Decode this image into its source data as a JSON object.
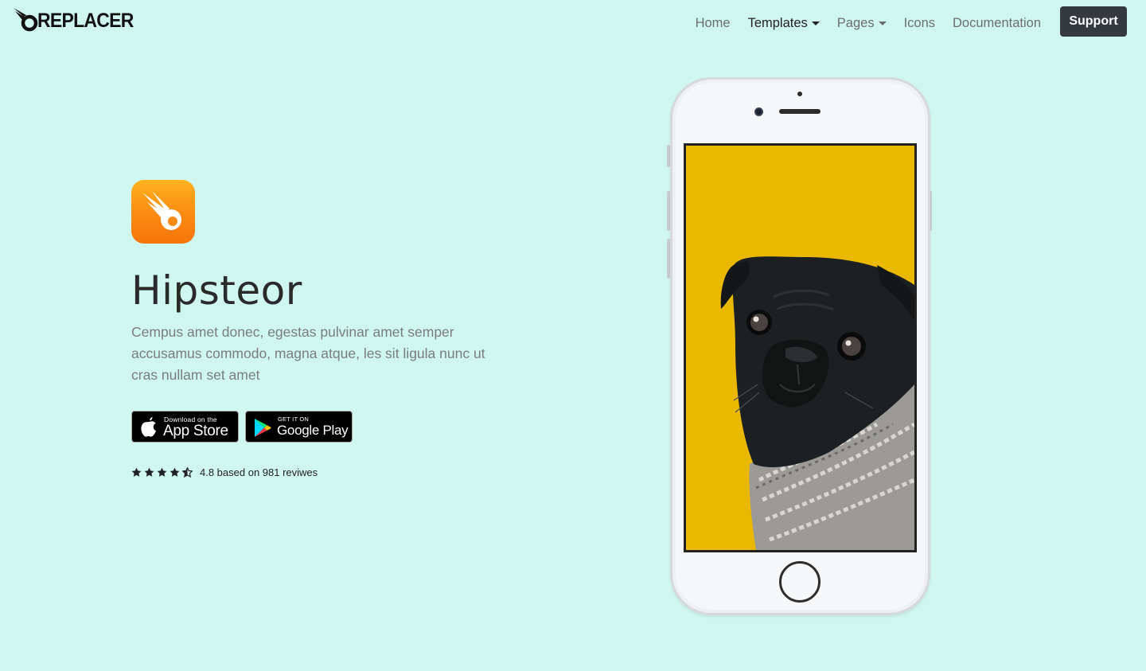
{
  "brand": {
    "name": "REPLACER",
    "icon": "replacer-logo-icon"
  },
  "nav": {
    "items": [
      {
        "label": "Home",
        "active": false,
        "dropdown": false
      },
      {
        "label": "Templates",
        "active": true,
        "dropdown": true
      },
      {
        "label": "Pages",
        "active": false,
        "dropdown": true
      },
      {
        "label": "Icons",
        "active": false,
        "dropdown": false
      },
      {
        "label": "Documentation",
        "active": false,
        "dropdown": false
      }
    ],
    "support_label": "Support"
  },
  "hero": {
    "app_icon": "comet-app-icon",
    "title": "Hipsteor",
    "description": "Cempus amet donec, egestas pulvinar amet semper accusamus commodo, magna atque, les sit ligula nunc ut cras nullam set amet",
    "app_store": {
      "small": "Download on the",
      "big": "App Store",
      "icon": "apple-icon"
    },
    "google_play": {
      "small": "GET IT ON",
      "big": "Google Play",
      "icon": "google-play-icon"
    },
    "rating": {
      "value": 4.5,
      "max": 5,
      "text": "4.8 based on 981 reviwes"
    }
  },
  "phone": {
    "screen_image": "pug-in-scarf-photo",
    "screen_bg": "#ebb800"
  },
  "colors": {
    "page_bg": "#d0f7ef",
    "support_bg": "#343a40",
    "accent_orange": "#fb8a12"
  }
}
